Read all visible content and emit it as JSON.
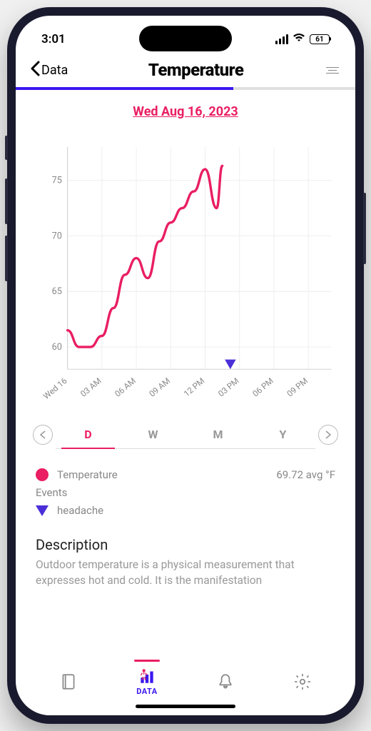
{
  "status": {
    "time": "3:01",
    "battery": "61"
  },
  "nav": {
    "back_label": "Data",
    "title": "Temperature"
  },
  "progress": 0.64,
  "date_header": "Wed Aug 16, 2023",
  "chart_data": {
    "type": "line",
    "x": [
      0,
      1,
      2,
      3,
      4,
      5,
      6,
      7,
      8,
      9,
      10,
      11,
      12,
      13
    ],
    "values": [
      61.5,
      60,
      60,
      61,
      63.5,
      66.5,
      68,
      66.2,
      69.5,
      71.2,
      72.5,
      74,
      76,
      72.5
    ],
    "ylim": [
      58,
      78
    ],
    "yticks": [
      60,
      65,
      70,
      75
    ],
    "xticks": [
      "Wed 16",
      "03 AM",
      "06 AM",
      "09 AM",
      "12 PM",
      "03 PM",
      "06 PM",
      "09 PM"
    ],
    "marker_x": 14.2,
    "last_point": {
      "x": 13.5,
      "y": 76.3
    },
    "color": "#e91e63",
    "xlabel": "",
    "ylabel": "",
    "title": ""
  },
  "range": {
    "tabs": [
      {
        "label": "D",
        "active": true
      },
      {
        "label": "W",
        "active": false
      },
      {
        "label": "M",
        "active": false
      },
      {
        "label": "Y",
        "active": false
      }
    ]
  },
  "legend": {
    "series_label": "Temperature",
    "avg_text": "69.72 avg °F",
    "events_label": "Events",
    "event_name": "headache"
  },
  "description": {
    "title": "Description",
    "text": "Outdoor temperature is a physical measurement that expresses hot and cold. It is the manifestation"
  },
  "tabs": {
    "data_label": "DATA"
  }
}
